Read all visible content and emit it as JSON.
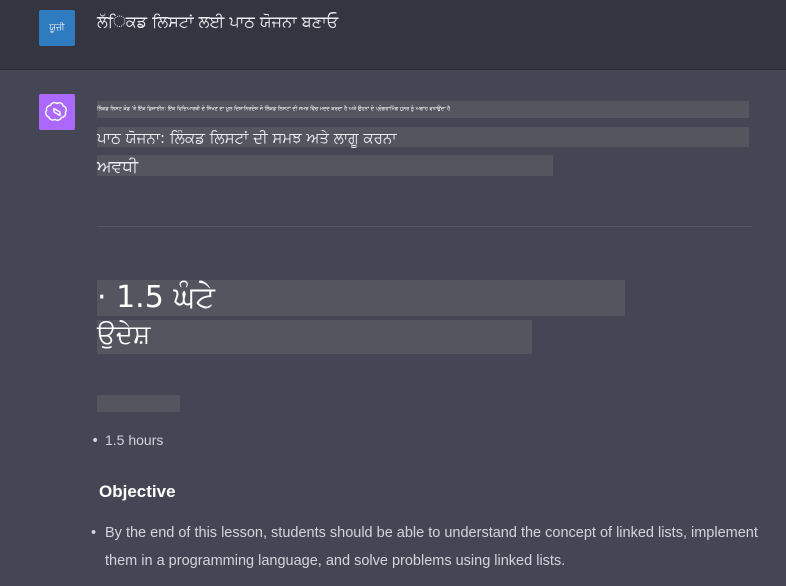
{
  "user": {
    "avatar_text": "ਯੂਜ਼ੀ",
    "message": "ਲੱਿਕਡ ਲਿਸਟਾਂ ਲਈ ਪਾਠ ਯੋਜਨਾ ਬਣਾਓ"
  },
  "assistant": {
    "tiny_line": "ਲਿੰਕਡ ਲਿਸਟ ਕੋਡ 'ਤੇ ਇੱਕ ਡਿਜ਼ਾਈਨ: ਇੱਕ ਵਿਦਿਆਰਥੀ ਦੇ ਸਿੱਖਣ ਦਾ ਮੂਲ ਦਿਸ਼ਾਨਿਰਦੇਸ਼ ਜੋ ਲਿੰਕਡ ਲਿਸਟਾਂ ਦੀ ਸਮਝ ਵਿੱਚ ਮਦਦ ਕਰਦਾ ਹੈ ਅਤੇ ਉਹਨਾਂ ਦੇ ਪ੍ਰੋਗਰਾਮਿੰਗ ਹੁਨਰ ਨੂੰ ਅਗਾਂਹ ਵਧਾਉਂਦਾ ਹੈ",
    "plan_title": "ਪਾਠ ਯੋਜਨਾ: ਲਿੰਕਡ ਲਿਸਟਾਂ ਦੀ ਸਮਝ ਅਤੇ ਲਾਗੂ ਕਰਨਾ",
    "duration_heading": "ਅਵਧੀ",
    "duration_bullet": "· 1.5 ਘੰਟੇ",
    "objective_heading_pa": "ਉਦੇਸ਼",
    "en_duration": "1.5 hours",
    "en_objective_heading": "Objective",
    "en_objective_text": "By the end of this lesson, students should be able to understand the concept of linked lists, implement them in a programming language, and solve problems using linked lists.",
    "bullet_char": "•"
  },
  "colors": {
    "page_bg": "#444654",
    "user_row_bg": "#343541",
    "user_avatar": "#2e7bbf",
    "assistant_avatar": "#ab68ff",
    "highlight_box": "#54555f"
  },
  "icons": {
    "assistant": "openai-logo-icon"
  }
}
